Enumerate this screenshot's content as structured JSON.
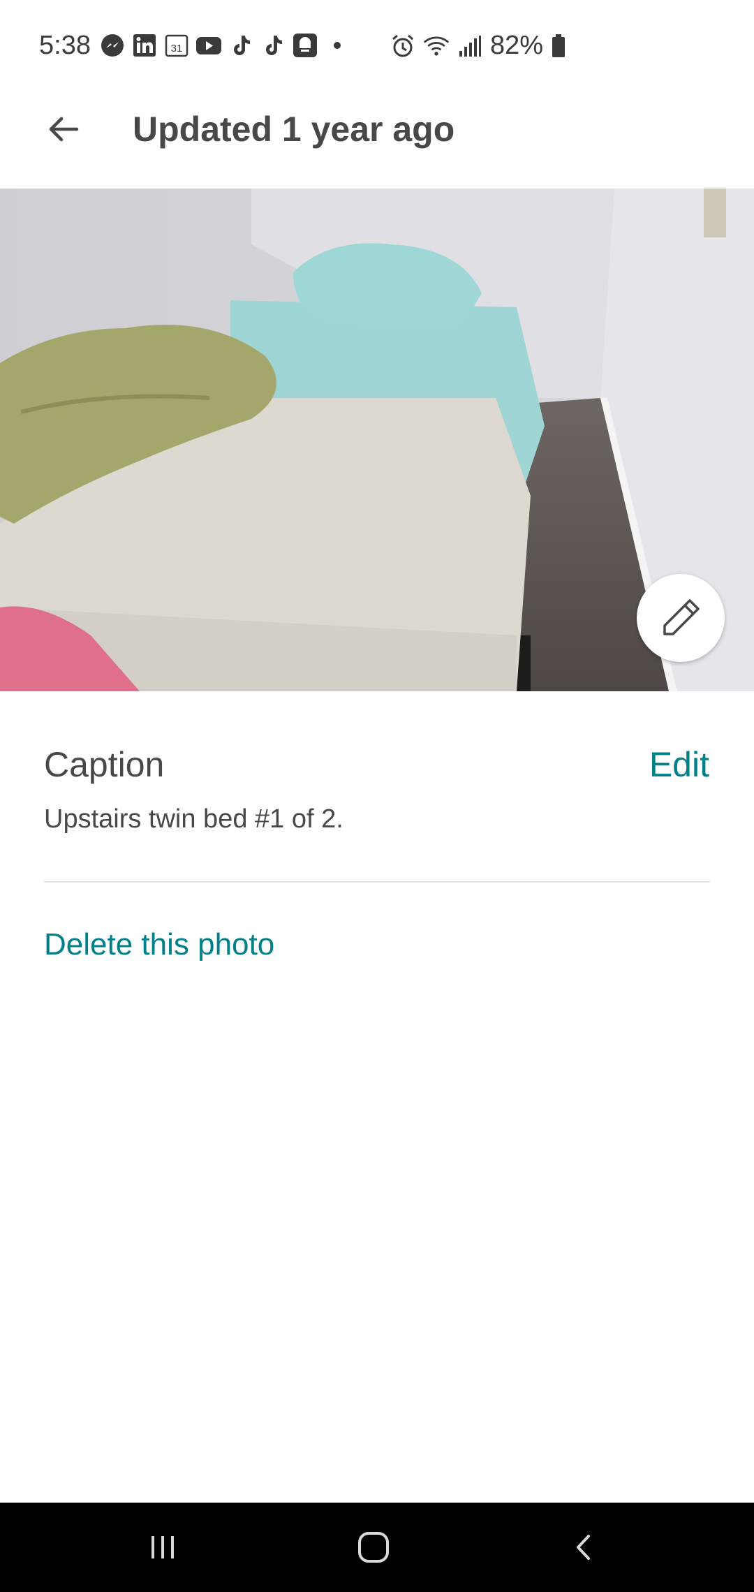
{
  "status_bar": {
    "time": "5:38",
    "left_icons": [
      "messenger-icon",
      "linkedin-icon",
      "calendar-icon",
      "youtube-icon",
      "tiktok-icon",
      "tiktok-icon",
      "notification-icon",
      "dot-icon"
    ],
    "calendar_day": "31",
    "right_icons": [
      "alarm-icon",
      "wifi-icon",
      "signal-icon",
      "battery-icon"
    ],
    "battery": "82%"
  },
  "app_bar": {
    "back_icon": "arrow-left-icon",
    "title": "Updated 1 year ago"
  },
  "photo": {
    "edit_icon": "pencil-icon"
  },
  "caption": {
    "label": "Caption",
    "edit_label": "Edit",
    "text": "Upstairs twin bed #1 of 2."
  },
  "actions": {
    "delete_label": "Delete this photo"
  },
  "nav_bar": {
    "recents_icon": "recents-icon",
    "home_icon": "home-icon",
    "back_icon": "back-chevron-icon"
  },
  "colors": {
    "accent": "#00818a",
    "text": "#484848",
    "nav_bar": "#000000"
  }
}
